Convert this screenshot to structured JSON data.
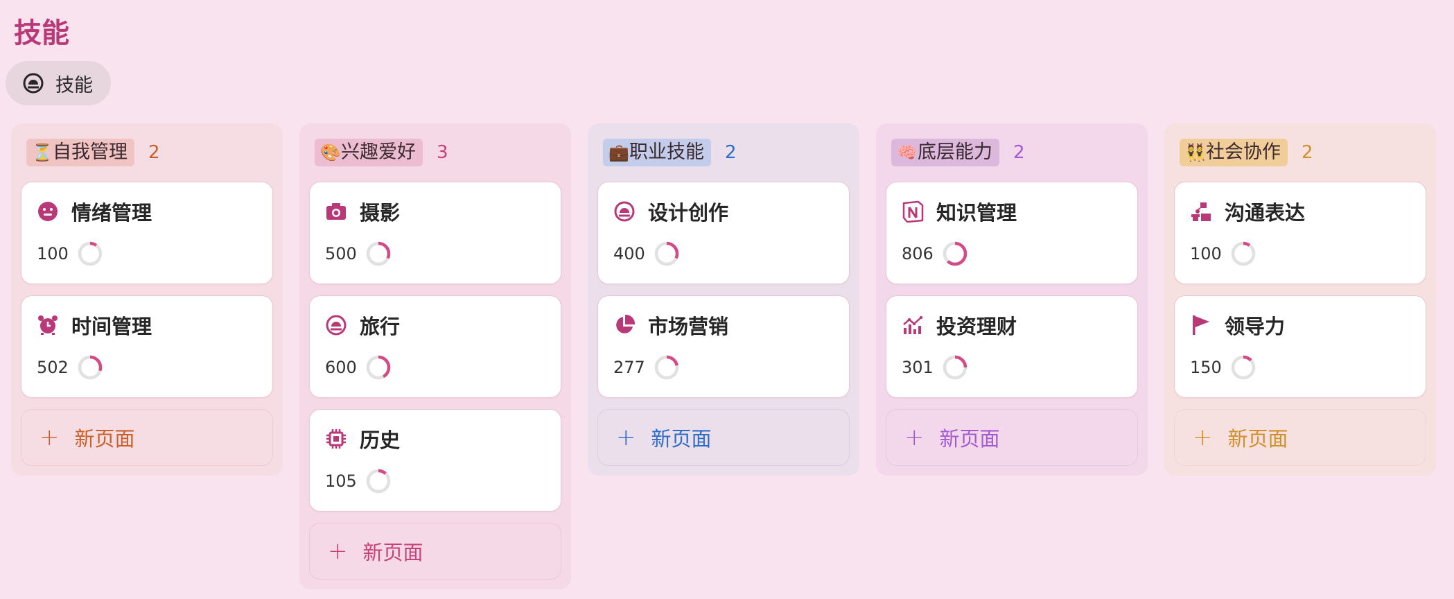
{
  "page": {
    "title": "技能"
  },
  "view_tab": {
    "label": "技能",
    "icon": "design-gauge-icon"
  },
  "accent": "#b83878",
  "new_page_label": "新页面",
  "columns": [
    {
      "emoji": "⏳",
      "label": "自我管理",
      "count": "2",
      "bg": "#f6dde3",
      "tag_bg": "#f1c4c4",
      "count_color": "#c8602a",
      "add_color": "#c8602a",
      "add_border": "#eccccf",
      "cards": [
        {
          "icon": "smiley-face-icon",
          "title": "情绪管理",
          "value": "100",
          "progress": 0.1
        },
        {
          "icon": "alarm-clock-icon",
          "title": "时间管理",
          "value": "502",
          "progress": 0.3
        }
      ]
    },
    {
      "emoji": "🎨",
      "label": "兴趣爱好",
      "count": "3",
      "bg": "#f5d9e6",
      "tag_bg": "#ecbcd0",
      "count_color": "#c8427a",
      "add_color": "#c8427a",
      "add_border": "#ecc6d6",
      "cards": [
        {
          "icon": "camera-icon",
          "title": "摄影",
          "value": "500",
          "progress": 0.32
        },
        {
          "icon": "design-gauge-icon",
          "title": "旅行",
          "value": "600",
          "progress": 0.42
        },
        {
          "icon": "cpu-chip-icon",
          "title": "历史",
          "value": "105",
          "progress": 0.12
        }
      ]
    },
    {
      "emoji": "💼",
      "label": "职业技能",
      "count": "2",
      "bg": "#ebdfec",
      "tag_bg": "#c4cceb",
      "count_color": "#2c6cc8",
      "add_color": "#2c6cc8",
      "add_border": "#d8cfe6",
      "cards": [
        {
          "icon": "design-gauge-icon",
          "title": "设计创作",
          "value": "400",
          "progress": 0.32
        },
        {
          "icon": "pie-chart-icon",
          "title": "市场营销",
          "value": "277",
          "progress": 0.22
        }
      ]
    },
    {
      "emoji": "🧠",
      "label": "底层能力",
      "count": "2",
      "bg": "#f2d8ea",
      "tag_bg": "#dcb9dc",
      "count_color": "#a25ad0",
      "add_color": "#a25ad0",
      "add_border": "#e6c8e2",
      "cards": [
        {
          "icon": "notion-logo-icon",
          "title": "知识管理",
          "value": "806",
          "progress": 0.62
        },
        {
          "icon": "bar-chart-trend-icon",
          "title": "投资理财",
          "value": "301",
          "progress": 0.25
        }
      ]
    },
    {
      "emoji": "👯",
      "label": "社会协作",
      "count": "2",
      "bg": "#f7e0e0",
      "tag_bg": "#f1cd9a",
      "count_color": "#d0902a",
      "add_color": "#d0902a",
      "add_border": "#eed8cc",
      "cards": [
        {
          "icon": "podium-communication-icon",
          "title": "沟通表达",
          "value": "100",
          "progress": 0.1
        },
        {
          "icon": "flag-icon",
          "title": "领导力",
          "value": "150",
          "progress": 0.13
        }
      ]
    }
  ]
}
